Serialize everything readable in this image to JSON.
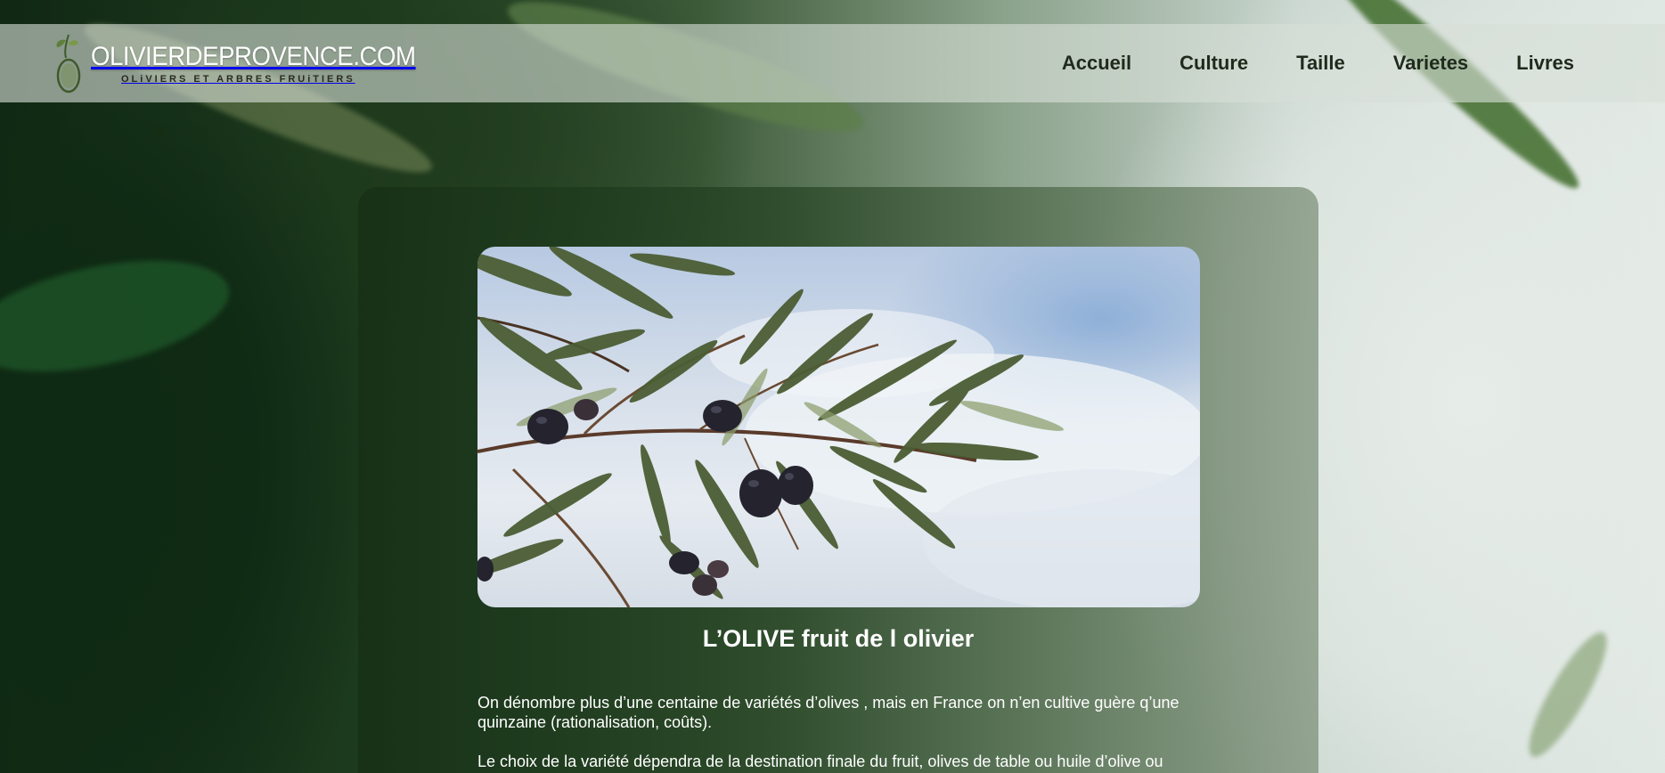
{
  "header": {
    "logo_title": "OLIVIERDEPROVENCE.COM",
    "logo_subtitle": "OLiVIERS ET ARBRES FRUiTIERS",
    "nav": [
      {
        "label": "Accueil"
      },
      {
        "label": "Culture"
      },
      {
        "label": "Taille"
      },
      {
        "label": "Varietes"
      },
      {
        "label": "Livres"
      }
    ]
  },
  "article": {
    "image_icon": "olive-branch-photo",
    "title": "L’OLIVE fruit de l olivier",
    "paragraphs": [
      "On dénombre plus d’une centaine de variétés d’olives , mais en France on n’en cultive guère q’une quinzaine (rationalisation, coûts).",
      "Le choix de la variété dépendra de la destination finale du fruit, olives de table ou huile d’olive ou"
    ]
  },
  "colors": {
    "nav_text": "#1f2a1c",
    "card_bg": "#1f3a1f",
    "text": "#ffffff"
  }
}
